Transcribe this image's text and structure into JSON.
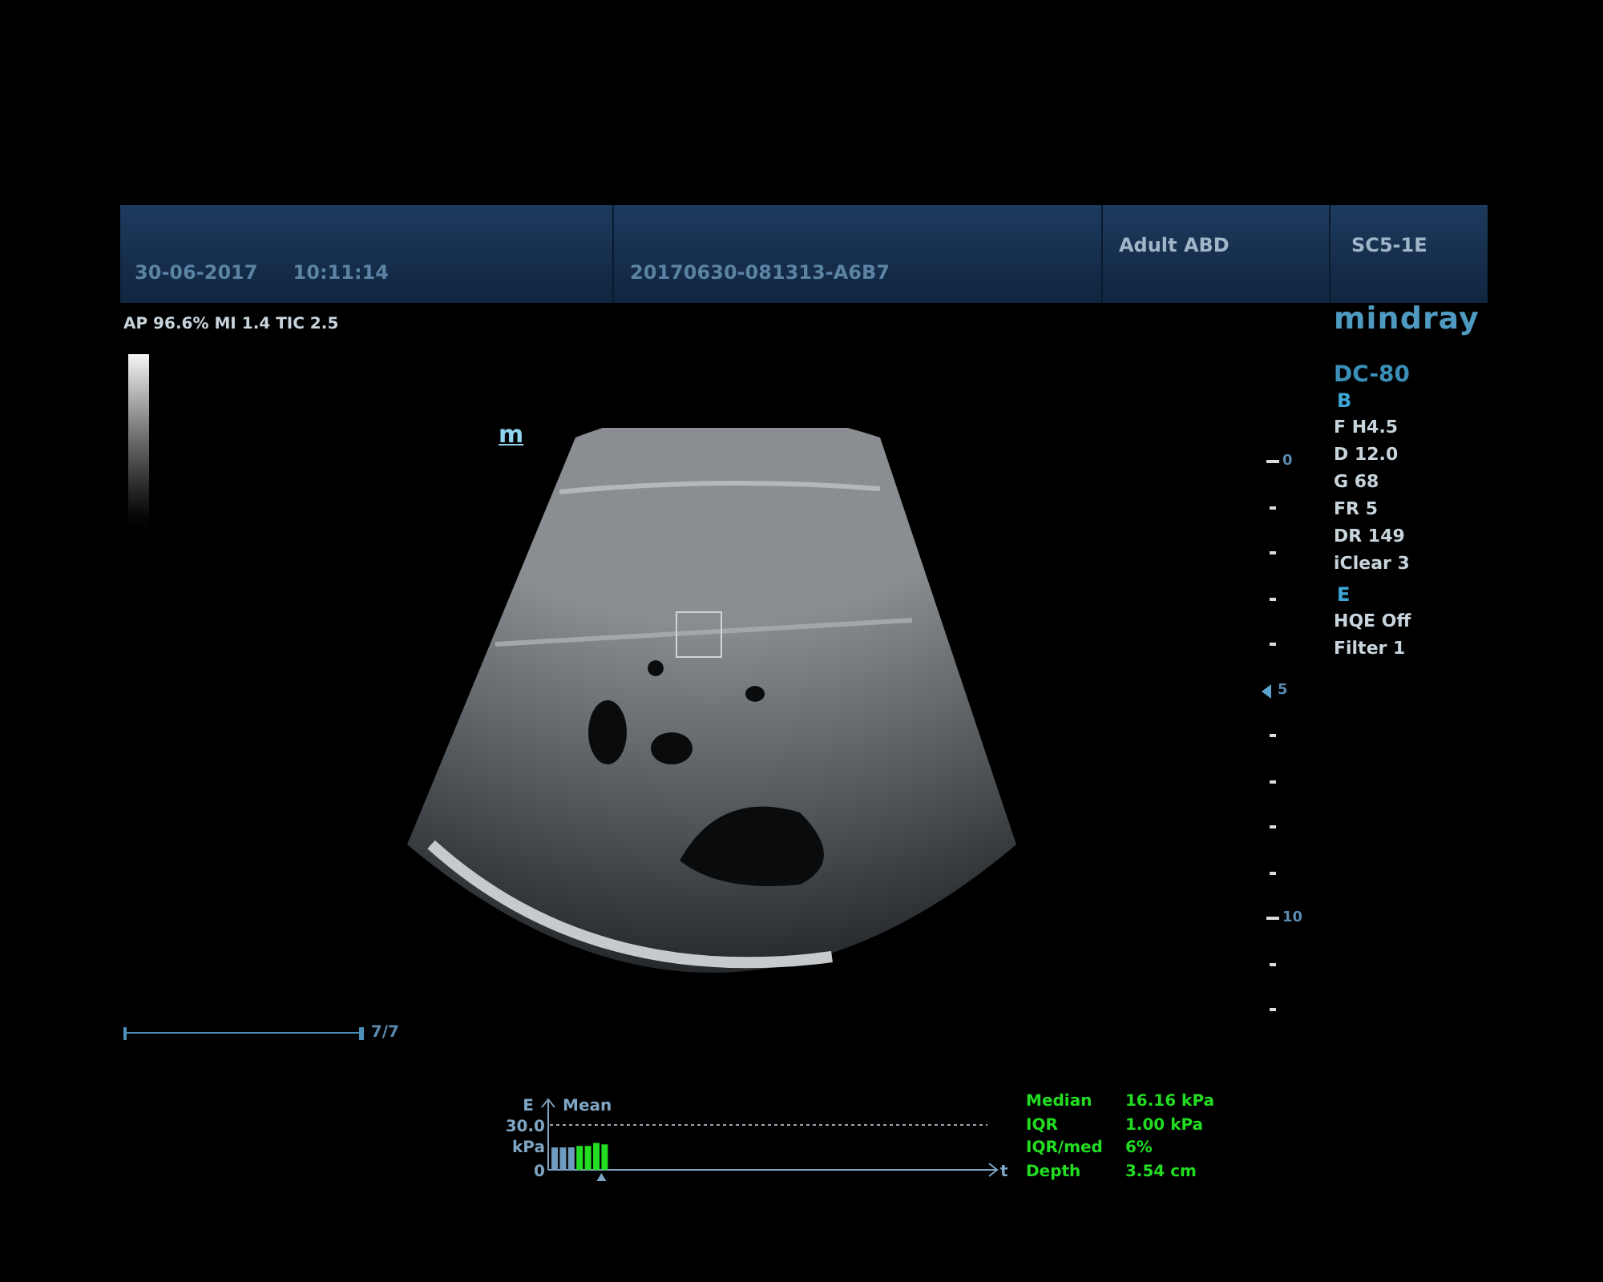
{
  "header": {
    "date": "30-06-2017",
    "time": "10:11:14",
    "exam_id": "20170630-081313-A6B7",
    "preset": "Adult ABD",
    "probe": "SC5-1E"
  },
  "acoustic_output": "AP 96.6%  MI 1.4 TIC 2.5",
  "brand": "mindray",
  "model": "DC-80",
  "orientation_mark": "m",
  "param_groups": [
    {
      "mode": "B",
      "params": [
        "F H4.5",
        "D 12.0",
        "G 68",
        "FR 5",
        "DR 149",
        "iClear 3"
      ]
    },
    {
      "mode": "E",
      "params": [
        "HQE Off",
        "Filter 1"
      ]
    }
  ],
  "depth_marks": [
    {
      "label": "0",
      "focus": false
    },
    {
      "label": "5",
      "focus": true
    },
    {
      "label": "10",
      "focus": false
    }
  ],
  "cine": {
    "label": "7/7",
    "level": 1
  },
  "stiffness_chart": {
    "unit": "kPa",
    "axis_end_label": "t",
    "chart_data": {
      "type": "bar",
      "title": "Mean",
      "ylabel": "E",
      "ylim": [
        0,
        30
      ],
      "yticks": [
        0,
        {
          "value": 30,
          "label": "30.0"
        }
      ],
      "stacked": true,
      "series": [
        {
          "color": "#6f9bbf",
          "values": [
            15,
            15,
            15,
            null,
            null,
            null,
            null
          ]
        },
        {
          "color": "#22dd22",
          "values": [
            null,
            null,
            null,
            16,
            16,
            18,
            17
          ]
        }
      ]
    }
  },
  "results": [
    {
      "label": "Median",
      "value": "16.16 kPa"
    },
    {
      "label": "IQR",
      "value": "1.00 kPa"
    },
    {
      "label": "IQR/med",
      "value": "6%"
    },
    {
      "label": "Depth",
      "value": "3.54 cm"
    }
  ]
}
